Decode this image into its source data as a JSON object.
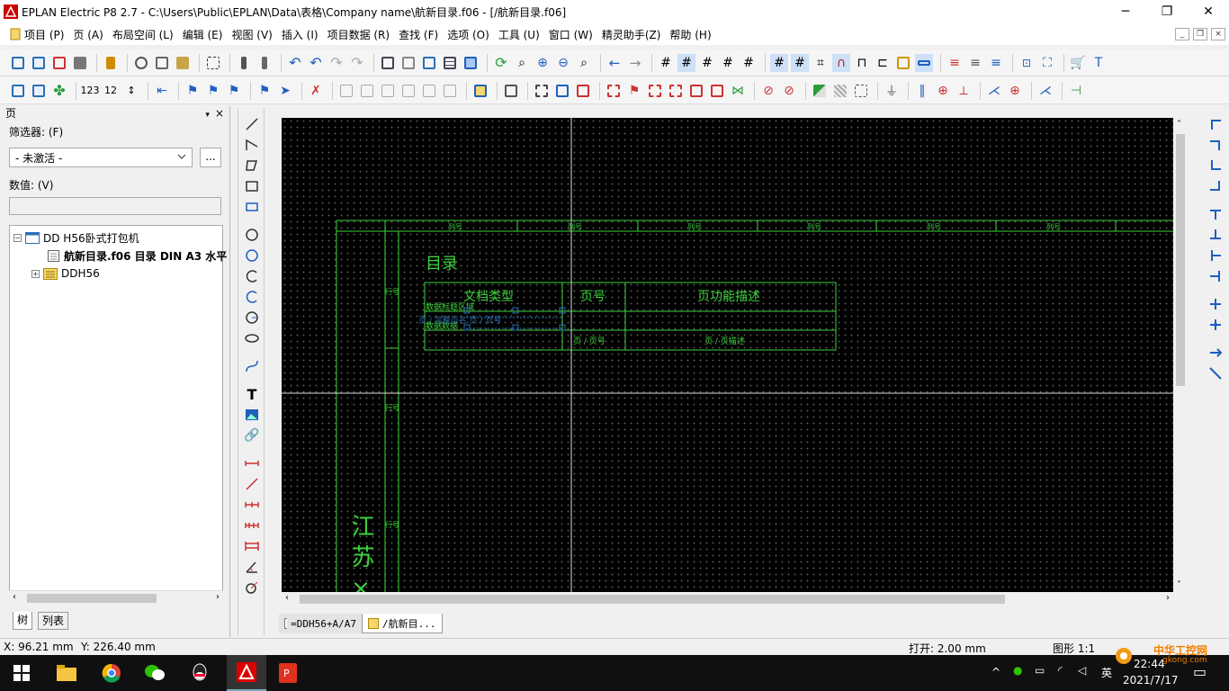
{
  "window": {
    "title": "EPLAN Electric P8 2.7 - C:\\Users\\Public\\EPLAN\\Data\\表格\\Company name\\航新目录.f06 - [/航新目录.f06]",
    "minimize": "─",
    "maximize": "❐",
    "close": "✕"
  },
  "menu": [
    "项目 (P)",
    "页 (A)",
    "布局空间 (L)",
    "编辑 (E)",
    "视图 (V)",
    "插入 (I)",
    "项目数据 (R)",
    "查找 (F)",
    "选项 (O)",
    "工具 (U)",
    "窗口 (W)",
    "精灵助手(Z)",
    "帮助 (H)"
  ],
  "mdi": {
    "min": "_",
    "restore": "❐",
    "close": "×"
  },
  "panel": {
    "title": "页",
    "pin": "▾",
    "close": "×",
    "filter_label": "筛选器: (F)",
    "filter_value": "- 未激活 -",
    "filter_more": "...",
    "value_label": "数值: (V)",
    "value": ""
  },
  "tree": {
    "root": "DD H56卧式打包机",
    "child1": "航新目录.f06 目录 DIN A3 水平",
    "child2": "DDH56"
  },
  "panel_tabs": [
    "树",
    "列表"
  ],
  "drawing": {
    "col_header": "列号",
    "title": "目录",
    "h_doctype": "文档类型",
    "h_page": "页号",
    "h_desc": "页功能描述",
    "ph_line1": "数据标题区域",
    "ph_line2": "数据数据",
    "ph_mid": "页 / 完整页名 页 / 页号",
    "ph_page": "页 / 页号",
    "ph_desc": "页 / 页描述",
    "row_label": "行号",
    "side_text": "江 苏 ×"
  },
  "doc_tabs": [
    "=DDH56+A/A7",
    "/航新目..."
  ],
  "status": {
    "x": "X: 96.21 mm",
    "y": "Y: 226.40 mm",
    "open": "打开: 2.00 mm",
    "graphic": "图形 1:1"
  },
  "tray": {
    "ime": "英",
    "time": "22:44",
    "date": "2021/7/17",
    "watermark": "中华工控网",
    "watermark_url": "gkong.com"
  },
  "colors": {
    "drawing_green": "#3cd23c",
    "canvas_bg": "#000000"
  }
}
